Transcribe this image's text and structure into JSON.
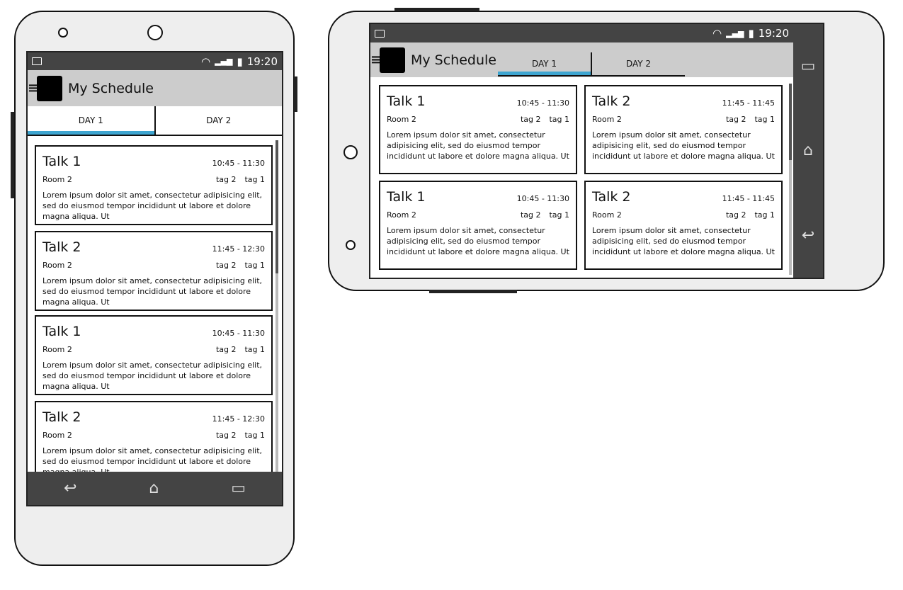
{
  "status": {
    "time": "19:20",
    "icons": [
      "image-icon",
      "wifi-icon",
      "signal-icon",
      "battery-icon"
    ]
  },
  "app": {
    "title": "My Schedule",
    "menu_icon": "hamburger-icon"
  },
  "tabs": [
    {
      "label": "DAY 1",
      "active": true
    },
    {
      "label": "DAY 2",
      "active": false
    }
  ],
  "accent": "#3ea5d0",
  "portrait_cards": [
    {
      "name": "Talk 1",
      "time": "10:45 - 11:30",
      "room": "Room 2",
      "tags": [
        "tag 2",
        "tag 1"
      ],
      "desc": "Lorem ipsum dolor sit amet, consectetur adipisicing elit, sed do eiusmod tempor incididunt ut labore et dolore magna aliqua. Ut"
    },
    {
      "name": "Talk 2",
      "time": "11:45 - 12:30",
      "room": "Room 2",
      "tags": [
        "tag 2",
        "tag 1"
      ],
      "desc": "Lorem ipsum dolor sit amet, consectetur adipisicing elit, sed do eiusmod tempor incididunt ut labore et dolore magna aliqua. Ut"
    },
    {
      "name": "Talk 1",
      "time": "10:45 - 11:30",
      "room": "Room 2",
      "tags": [
        "tag 2",
        "tag 1"
      ],
      "desc": "Lorem ipsum dolor sit amet, consectetur adipisicing elit, sed do eiusmod tempor incididunt ut labore et dolore magna aliqua. Ut"
    },
    {
      "name": "Talk 2",
      "time": "11:45 - 12:30",
      "room": "Room 2",
      "tags": [
        "tag 2",
        "tag 1"
      ],
      "desc": "Lorem ipsum dolor sit amet, consectetur adipisicing elit, sed do eiusmod tempor incididunt ut labore et dolore magna aliqua. Ut"
    }
  ],
  "landscape_cards": [
    {
      "name": "Talk 1",
      "time": "10:45 - 11:30",
      "room": "Room 2",
      "tags": [
        "tag 2",
        "tag 1"
      ],
      "desc": "Lorem ipsum dolor sit amet, consectetur adipisicing elit, sed do eiusmod tempor incididunt ut labore et dolore magna aliqua. Ut"
    },
    {
      "name": "Talk 2",
      "time": "11:45 - 11:45",
      "room": "Room 2",
      "tags": [
        "tag 2",
        "tag 1"
      ],
      "desc": "Lorem ipsum dolor sit amet, consectetur adipisicing elit, sed do eiusmod tempor incididunt ut labore et dolore magna aliqua. Ut"
    },
    {
      "name": "Talk 1",
      "time": "10:45 - 11:30",
      "room": "Room 2",
      "tags": [
        "tag 2",
        "tag 1"
      ],
      "desc": "Lorem ipsum dolor sit amet, consectetur adipisicing elit, sed do eiusmod tempor incididunt ut labore et dolore magna aliqua. Ut"
    },
    {
      "name": "Talk 2",
      "time": "11:45 - 11:45",
      "room": "Room 2",
      "tags": [
        "tag 2",
        "tag 1"
      ],
      "desc": "Lorem ipsum dolor sit amet, consectetur adipisicing elit, sed do eiusmod tempor incididunt ut labore et dolore magna aliqua. Ut"
    }
  ],
  "nav": {
    "back": "↩",
    "home": "⌂",
    "recents": "▭"
  }
}
